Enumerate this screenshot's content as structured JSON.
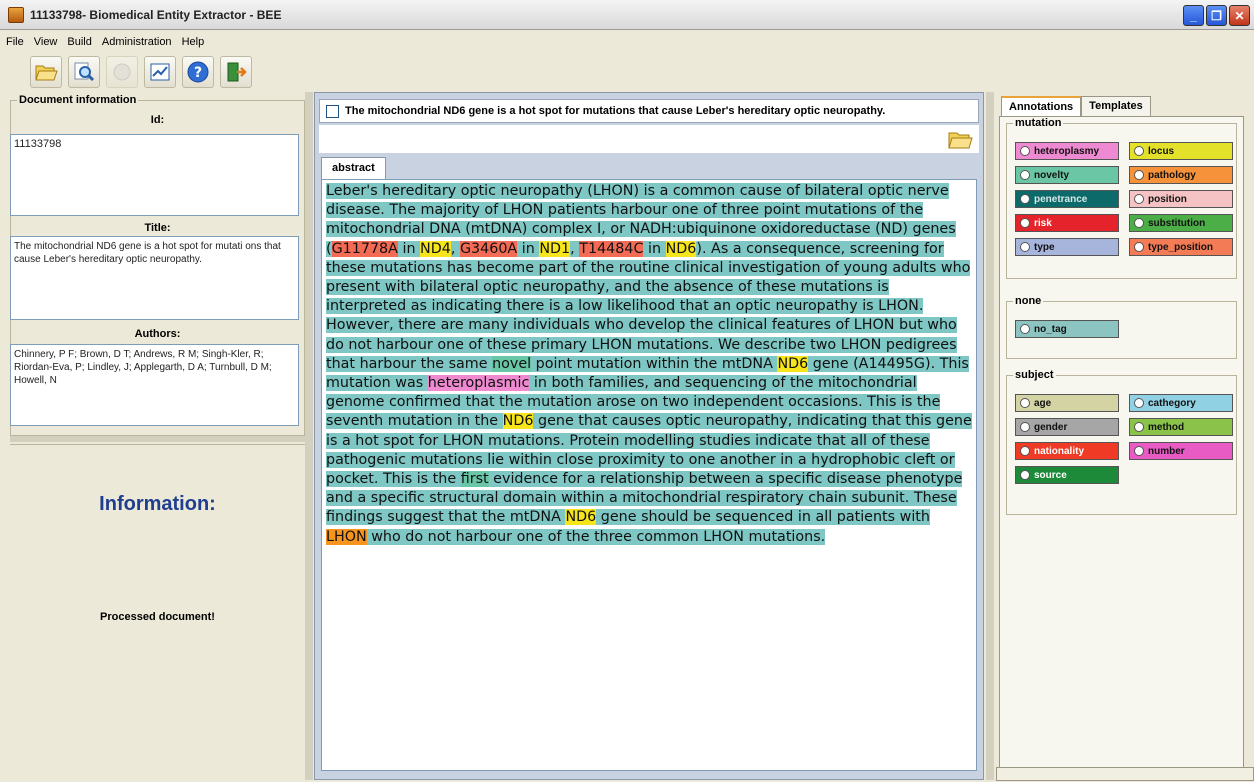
{
  "window": {
    "title": "11133798- Biomedical Entity Extractor - BEE"
  },
  "menu": [
    "File",
    "View",
    "Build",
    "Administration",
    "Help"
  ],
  "toolbar": [
    "open-folder-icon",
    "search-icon",
    "disabled-icon",
    "chart-icon",
    "help-icon",
    "exit-icon"
  ],
  "left": {
    "group_label": "Document information",
    "id_label": "Id:",
    "id_value": "11133798",
    "title_label": "Title:",
    "title_value": "The mitochondrial ND6 gene is a hot spot for mutati ons that cause Leber's hereditary optic neuropathy.",
    "authors_label": "Authors:",
    "authors_value": "Chinnery, P F; Brown, D T; Andrews, R M; Singh-Kler, R; Riordan-Eva, P; Lindley, J; Applegarth, D A; Turnbull, D M; Howell, N",
    "info_title": "Information:",
    "info_msg": "Processed document!"
  },
  "center": {
    "doc_title": "The mitochondrial ND6 gene is a hot spot for mutations that cause Leber's hereditary optic neuropathy.",
    "tab": "abstract",
    "segments": [
      [
        "hl",
        "Leber's hereditary optic neuropathy (LHON) is a common cause of bilateral optic nerve disease. The majority of LHON patients harbour one of three point mutations of the mitochondrial DNA (mtDNA) complex I, or NADH:ubiquinone oxidoreductase (ND) genes ("
      ],
      [
        "mut",
        "G11778A"
      ],
      [
        "hl",
        " in "
      ],
      [
        "nd",
        "ND4"
      ],
      [
        "hl",
        ", "
      ],
      [
        "mut",
        "G3460A"
      ],
      [
        "hl",
        " in "
      ],
      [
        "nd",
        "ND1"
      ],
      [
        "hl",
        ", "
      ],
      [
        "mut",
        "T14484C"
      ],
      [
        "hl",
        " in "
      ],
      [
        "nd",
        "ND6"
      ],
      [
        "hl",
        "). As a consequence, screening for these mutations has become part of the routine clinical investigation of young adults who present with bilateral optic neuropathy, and the absence of these mutations is interpreted as indicating there is a low likelihood that an optic neuropathy is LHON. However, there are many individuals who develop the clinical features of LHON but who do not harbour one of these primary LHON mutations. We describe two LHON pedigrees that harbour the same "
      ],
      [
        "nov",
        "novel"
      ],
      [
        "hl",
        " point mutation within the mtDNA "
      ],
      [
        "nd",
        "ND6"
      ],
      [
        "hl",
        " gene (A14495G). This mutation was "
      ],
      [
        "het",
        "heteroplasmic"
      ],
      [
        "hl",
        " in both families, and sequencing of the mitochondrial genome confirmed that the mutation arose on two independent occasions. This is the seventh mutation in the "
      ],
      [
        "nd",
        "ND6"
      ],
      [
        "hl",
        " gene that causes optic neuropathy, indicating that this gene is a hot spot for LHON mutations. Protein modelling studies indicate that all of these pathogenic mutations lie within close proximity to one another in a hydrophobic cleft or pocket. This is the "
      ],
      [
        "nov",
        "first"
      ],
      [
        "hl",
        " evidence for a relationship between a specific disease phenotype and a specific structural domain within a mitochondrial respiratory chain subunit. These findings suggest that the mtDNA "
      ],
      [
        "nd",
        "ND6"
      ],
      [
        "hl",
        " gene should be sequenced in all patients with "
      ],
      [
        "lhon",
        "LHON"
      ],
      [
        "hl",
        " who do not harbour one of the three common LHON mutations."
      ]
    ]
  },
  "right": {
    "tabs": [
      "Annotations",
      "Templates"
    ],
    "groups": [
      {
        "label": "mutation",
        "tags": [
          {
            "name": "heteroplasmy",
            "color": "#ee8ad1"
          },
          {
            "name": "locus",
            "color": "#e3e12a"
          },
          {
            "name": "novelty",
            "color": "#6bc6a5"
          },
          {
            "name": "pathology",
            "color": "#f6923a"
          },
          {
            "name": "penetrance",
            "color": "#0d6a6a",
            "fg": "#d8e8e8"
          },
          {
            "name": "position",
            "color": "#f5c3c3"
          },
          {
            "name": "risk",
            "color": "#e4242a",
            "fg": "#fff"
          },
          {
            "name": "substitution",
            "color": "#4cae47"
          },
          {
            "name": "type",
            "color": "#a7b5dd"
          },
          {
            "name": "type_position",
            "color": "#f37b55"
          }
        ]
      },
      {
        "label": "none",
        "tags": [
          {
            "name": "no_tag",
            "color": "#8cc4c1"
          }
        ]
      },
      {
        "label": "subject",
        "tags": [
          {
            "name": "age",
            "color": "#d3d3a4"
          },
          {
            "name": "cathegory",
            "color": "#91d1e4"
          },
          {
            "name": "gender",
            "color": "#a6a6a6"
          },
          {
            "name": "method",
            "color": "#8bc34a"
          },
          {
            "name": "nationality",
            "color": "#ef3b25",
            "fg": "#fff"
          },
          {
            "name": "number",
            "color": "#e85ac4"
          },
          {
            "name": "source",
            "color": "#1d8a3a",
            "fg": "#fff"
          }
        ]
      }
    ]
  }
}
